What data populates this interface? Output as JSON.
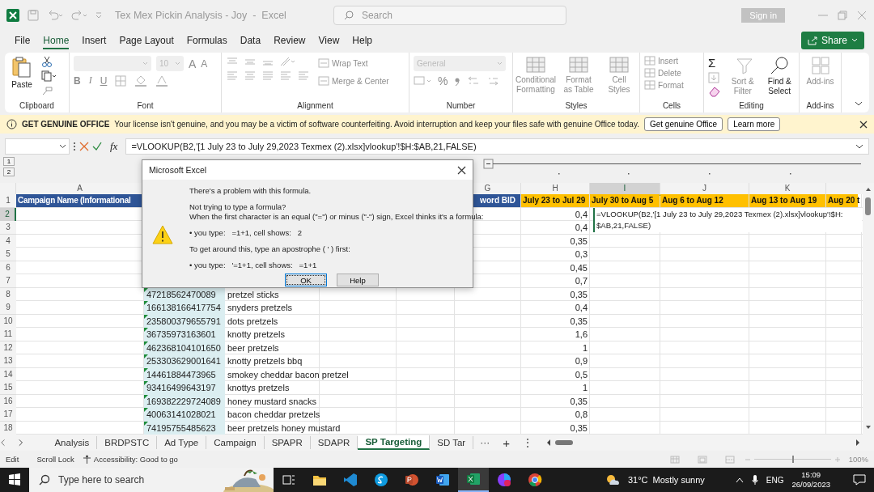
{
  "window": {
    "title": "Tex Mex Pickin Analysis - Joy  -  Excel",
    "search_placeholder": "Search",
    "sign_in": "Sign in"
  },
  "menu": [
    {
      "label": "File",
      "selected": false
    },
    {
      "label": "Home",
      "selected": true
    },
    {
      "label": "Insert",
      "selected": false
    },
    {
      "label": "Page Layout",
      "selected": false
    },
    {
      "label": "Formulas",
      "selected": false
    },
    {
      "label": "Data",
      "selected": false
    },
    {
      "label": "Review",
      "selected": false
    },
    {
      "label": "View",
      "selected": false
    },
    {
      "label": "Help",
      "selected": false
    }
  ],
  "share": "Share",
  "ribbon": [
    {
      "kind": "clipboard",
      "label": "Clipboard",
      "paste": {
        "label": "Paste",
        "disabled": false
      }
    },
    {
      "kind": "font",
      "label": "Font",
      "size": "10",
      "size_buttons": [
        "A",
        "A"
      ],
      "style_buttons": [
        "B",
        "I",
        "U"
      ]
    },
    {
      "kind": "alignment",
      "label": "Alignment",
      "buttons": [
        {
          "label": "Wrap Text",
          "disabled": true
        },
        {
          "label": "Merge & Center",
          "disabled": true
        }
      ]
    },
    {
      "kind": "number",
      "label": "Number",
      "format": "General",
      "symbol": "%"
    },
    {
      "kind": "styles",
      "label": "Styles",
      "buttons": [
        {
          "label": "Conditional Formatting",
          "disabled": true
        },
        {
          "label": "Format as Table",
          "disabled": true
        },
        {
          "label": "Cell Styles",
          "disabled": true
        }
      ]
    },
    {
      "kind": "cells",
      "label": "Cells",
      "buttons": [
        {
          "label": "Insert",
          "disabled": true
        },
        {
          "label": "Delete",
          "disabled": true
        },
        {
          "label": "Format",
          "disabled": true
        }
      ]
    },
    {
      "kind": "editing",
      "label": "Editing",
      "sum": "Σ",
      "buttons": [
        {
          "label": "Sort & Filter",
          "disabled": true
        },
        {
          "label": "Find & Select",
          "disabled": false
        }
      ]
    },
    {
      "kind": "addins",
      "label": "Add-ins",
      "buttons": [
        {
          "label": "Add-ins",
          "disabled": true
        }
      ]
    }
  ],
  "banner": {
    "title": "GET GENUINE OFFICE",
    "message": "Your license isn't genuine, and you may be a victim of software counterfeiting. Avoid interruption and keep your files safe with genuine Office today.",
    "buttons": [
      "Get genuine Office",
      "Learn more"
    ]
  },
  "formula_bar": {
    "fx": "fx",
    "formula": "=VLOOKUP(B2,'[1 July 23 to July 29,2023 Texmex (2).xlsx]vlookup'!$H:$AB,21,FALSE)"
  },
  "outline": {
    "levels": [
      "1",
      "2"
    ]
  },
  "columns": [
    {
      "label": "A",
      "selected": false
    },
    {
      "label": "G",
      "selected": false
    },
    {
      "label": "H",
      "selected": false
    },
    {
      "label": "I",
      "selected": true
    },
    {
      "label": "J",
      "selected": false
    },
    {
      "label": "K",
      "selected": false
    }
  ],
  "rows": [
    {
      "number": "1",
      "selected": false,
      "cells": {
        "a": {
          "text": "Campaign Name (Informational",
          "color": "#2f5597"
        },
        "g": {
          "text": "word BID",
          "color": "#2f5597"
        },
        "h": {
          "text": "July 23 to Jul 29",
          "color": "#ffc000"
        },
        "i": {
          "text": "July 30 to Aug 5",
          "color": "#ffc000"
        },
        "j": {
          "text": "Aug 6 to Aug 12",
          "color": "#ffc000"
        },
        "k": {
          "text": "Aug 13 to Aug 19",
          "color": "#ffc000"
        },
        "l": {
          "text": "Aug 20 t",
          "color": "#ffc000"
        }
      }
    },
    {
      "number": "2",
      "selected": true,
      "cells": {
        "h": "0,4"
      }
    },
    {
      "number": "3",
      "selected": false,
      "cells": {
        "h": "0,4"
      }
    },
    {
      "number": "4",
      "selected": false,
      "cells": {
        "h": "0,35"
      }
    },
    {
      "number": "5",
      "selected": false,
      "cells": {
        "h": "0,3"
      }
    },
    {
      "number": "6",
      "selected": false,
      "cells": {
        "h": "0,45"
      }
    },
    {
      "number": "7",
      "selected": false,
      "cells": {
        "h": "0,7"
      }
    },
    {
      "number": "8",
      "selected": false,
      "cells": {
        "b": "47218562470089",
        "c": "pretzel sticks",
        "h": "0,35"
      }
    },
    {
      "number": "9",
      "selected": false,
      "cells": {
        "b": "166138166417754",
        "c": "snyders pretzels",
        "h": "0,4"
      }
    },
    {
      "number": "10",
      "selected": false,
      "cells": {
        "b": "235800379655791",
        "c": "dots pretzels",
        "h": "0,35"
      }
    },
    {
      "number": "11",
      "selected": false,
      "cells": {
        "b": "36735973163601",
        "c": "knotty pretzels",
        "h": "1,6"
      }
    },
    {
      "number": "12",
      "selected": false,
      "cells": {
        "b": "462368104101650",
        "c": "beer pretzels",
        "h": "1"
      }
    },
    {
      "number": "13",
      "selected": false,
      "cells": {
        "b": "253303629001641",
        "c": "knotty pretzels bbq",
        "h": "0,9"
      }
    },
    {
      "number": "14",
      "selected": false,
      "cells": {
        "b": "14461884473965",
        "c": "smokey cheddar bacon pretzel",
        "h": "0,5"
      }
    },
    {
      "number": "15",
      "selected": false,
      "cells": {
        "b": "93416499643197",
        "c": "knottys pretzels",
        "h": "1"
      }
    },
    {
      "number": "16",
      "selected": false,
      "cells": {
        "b": "169382229724089",
        "c": "honey mustard snacks",
        "h": "0,35"
      }
    },
    {
      "number": "17",
      "selected": false,
      "cells": {
        "b": "40063141028021",
        "c": "bacon cheddar pretzels",
        "h": "0,8"
      }
    },
    {
      "number": "18",
      "selected": false,
      "cells": {
        "b": "74195755485623",
        "c": "beer pretzels honey mustard",
        "h": "0,35"
      }
    }
  ],
  "editor": {
    "lines": [
      "=VLOOKUP(B2,'[1 July 23 to July 29,2023 Texmex (2).xlsx]vlookup'!$H:",
      "$AB,21,FALSE)"
    ]
  },
  "dialog": {
    "title": "Microsoft Excel",
    "lines": [
      "There's a problem with this formula.",
      "Not trying to type a formula?",
      "When the first character is an equal (\"=\") or minus (\"-\") sign, Excel thinks it's a formula:",
      "• you type:   =1+1, cell shows:   2",
      "To get around this, type an apostrophe ( ' ) first:",
      "• you type:   '=1+1, cell shows:   =1+1"
    ],
    "buttons": [
      {
        "label": "OK",
        "selected": true
      },
      {
        "label": "Help",
        "selected": false
      }
    ]
  },
  "sheet_tabs": [
    {
      "label": "Analysis",
      "selected": false
    },
    {
      "label": "BRDPSTC",
      "selected": false
    },
    {
      "label": "Ad Type",
      "selected": false
    },
    {
      "label": "Campaign",
      "selected": false
    },
    {
      "label": "SPAPR",
      "selected": false
    },
    {
      "label": "SDAPR",
      "selected": false
    },
    {
      "label": "SP Targeting",
      "selected": true
    },
    {
      "label": "SD Tar",
      "selected": false
    }
  ],
  "sheet_more": "···",
  "sheet_add": "+",
  "sheet_menu": "⋮",
  "status_bar": {
    "mode": "Edit",
    "scroll_lock": "Scroll Lock",
    "accessibility": "Accessibility: Good to go",
    "zoom": {
      "level": 0.5,
      "reading": "100%"
    }
  },
  "taskbar": {
    "search_placeholder": "Type here to search",
    "weather": "31°C  Mostly sunny",
    "language": "ENG",
    "time": "15:09",
    "date": "26/09/2023"
  }
}
